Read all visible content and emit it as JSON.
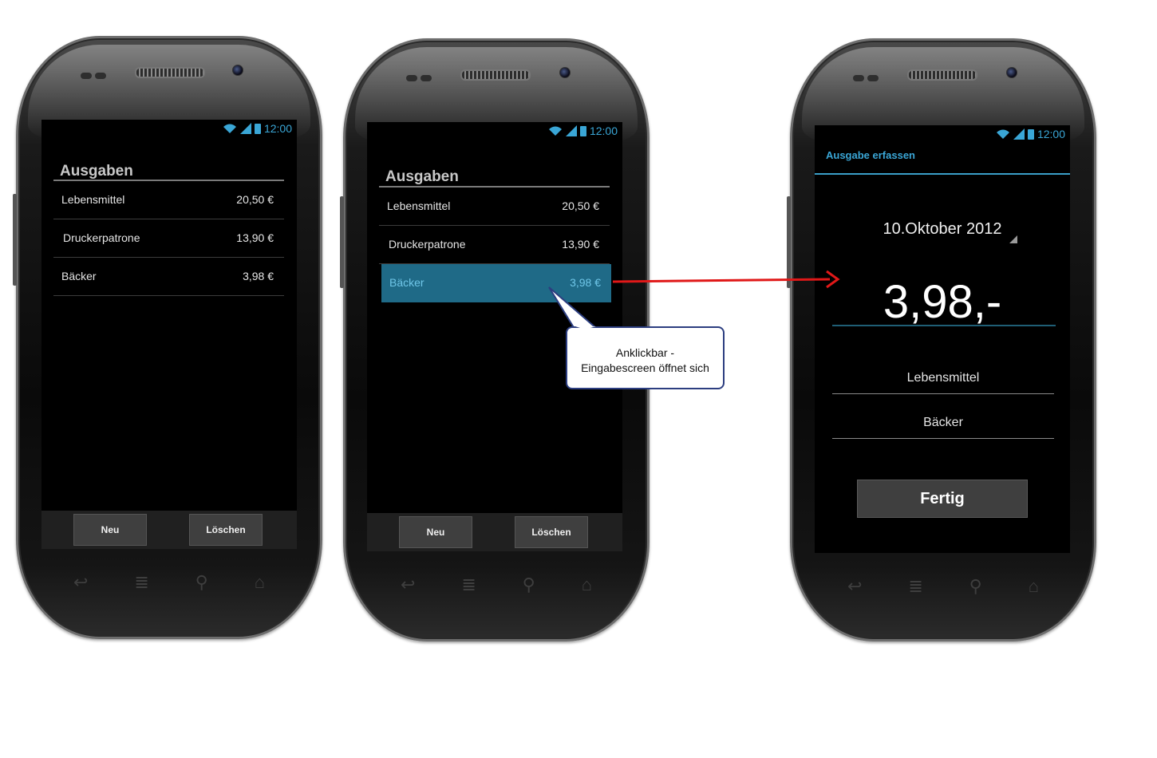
{
  "status": {
    "time": "12:00"
  },
  "list": {
    "title": "Ausgaben",
    "items": [
      {
        "label": "Lebensmittel",
        "amount": "20,50 €"
      },
      {
        "label": "Druckerpatrone",
        "amount": "13,90 €"
      },
      {
        "label": "Bäcker",
        "amount": "3,98 €"
      }
    ],
    "new_button": "Neu",
    "delete_button": "Löschen"
  },
  "callout": {
    "line1": "Anklickbar -",
    "line2": "Eingabescreen öffnet sich"
  },
  "entry": {
    "title": "Ausgabe erfassen",
    "date": "10.Oktober 2012",
    "amount": "3,98,-",
    "category": "Lebensmittel",
    "description": "Bäcker",
    "done_button": "Fertig"
  },
  "colors": {
    "accent": "#3aa6d6",
    "selected_row": "#1f6a87",
    "arrow": "#e01818",
    "callout_border": "#2c3e80"
  },
  "icons": [
    "wifi-icon",
    "signal-icon",
    "battery-icon",
    "back-icon",
    "menu-icon",
    "search-icon",
    "home-icon"
  ]
}
